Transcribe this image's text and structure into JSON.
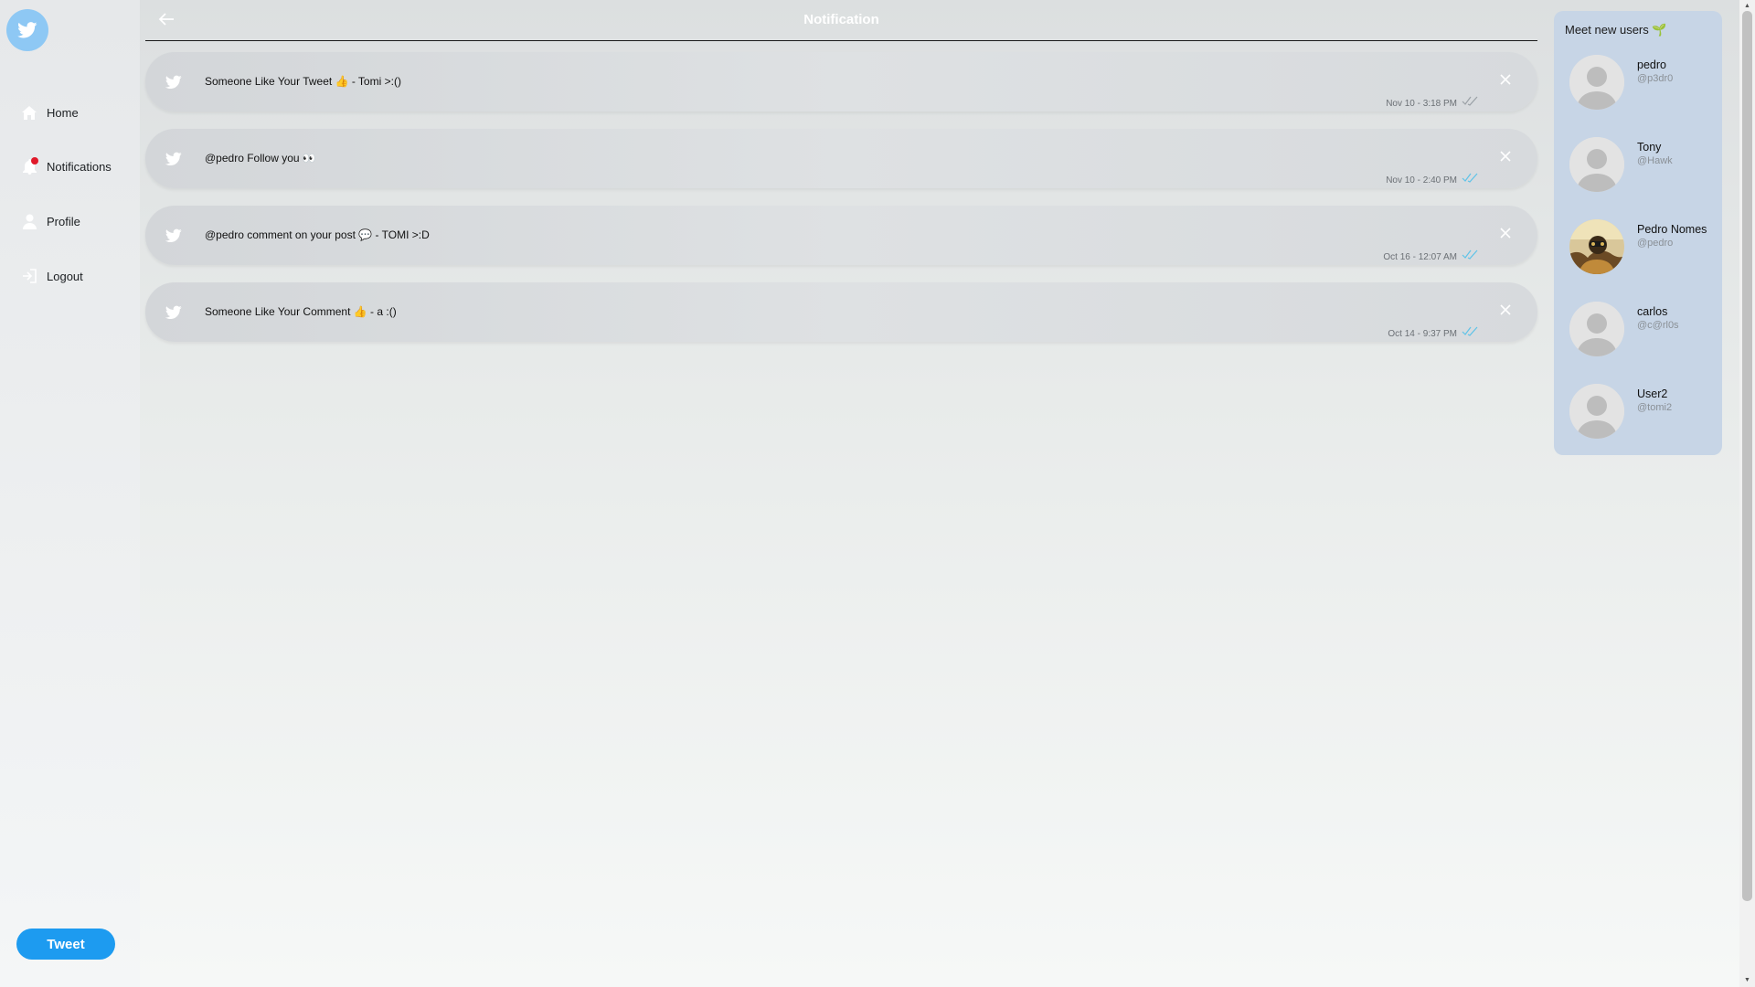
{
  "header": {
    "title": "Notification"
  },
  "sidebar": {
    "items": [
      {
        "label": "Home",
        "icon": "home-icon"
      },
      {
        "label": "Notifications",
        "icon": "bell-icon",
        "has_badge": true
      },
      {
        "label": "Profile",
        "icon": "user-icon"
      },
      {
        "label": "Logout",
        "icon": "logout-icon"
      }
    ],
    "tweet_label": "Tweet"
  },
  "notifications": [
    {
      "text": "Someone Like Your Tweet 👍 - Tomi >:()",
      "time": "Nov 10 - 3:18 PM",
      "read": false
    },
    {
      "text": "@pedro Follow you 👀",
      "time": "Nov 10 - 2:40 PM",
      "read": true
    },
    {
      "text": "@pedro comment on your post 💬 - TOMI >:D",
      "time": "Oct 16 - 12:07 AM",
      "read": true
    },
    {
      "text": "Someone Like Your Comment 👍 - a :()",
      "time": "Oct 14 - 9:37 PM",
      "read": true
    }
  ],
  "users_panel": {
    "title": "Meet new users 🌱",
    "users": [
      {
        "name": "pedro",
        "handle": "@p3dr0",
        "avatar": "default"
      },
      {
        "name": "Tony",
        "handle": "@Hawk",
        "avatar": "default"
      },
      {
        "name": "Pedro Nomes",
        "handle": "@pedro",
        "avatar": "photo"
      },
      {
        "name": "carlos",
        "handle": "@c@rl0s",
        "avatar": "default"
      },
      {
        "name": "User2",
        "handle": "@tomi2",
        "avatar": "default"
      }
    ]
  },
  "colors": {
    "accent": "#1d9bf0",
    "logo_bg": "#8ec8f4",
    "badge": "#e0192a",
    "panel_bg": "#c7d5e6",
    "read_check": "#5ec3e8",
    "unread_check": "#9aa0a6"
  }
}
